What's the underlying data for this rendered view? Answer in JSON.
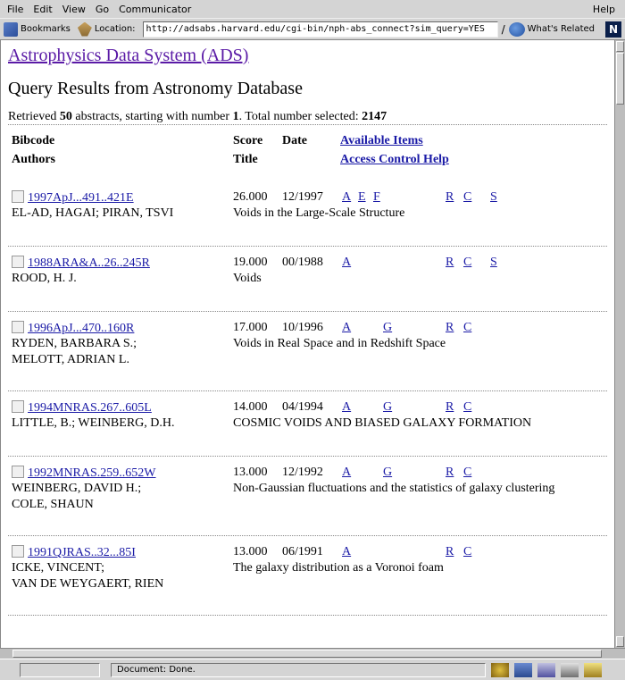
{
  "menubar": {
    "items": [
      "File",
      "Edit",
      "View",
      "Go",
      "Communicator"
    ],
    "help": "Help"
  },
  "toolbar": {
    "bookmarks_label": "Bookmarks",
    "location_label": "Location:",
    "url": "http://adsabs.harvard.edu/cgi-bin/nph-abs_connect?sim_query=YES",
    "related_label": "What's Related",
    "logo": "N"
  },
  "page": {
    "site_title": "Astrophysics Data System (ADS)",
    "heading": "Query Results from Astronomy Database",
    "summary_pre": "Retrieved ",
    "retrieved": "50",
    "summary_mid": " abstracts, starting with number ",
    "start": "1",
    "summary_post": ". Total number selected: ",
    "total": "2147",
    "headers": {
      "bibcode": "Bibcode",
      "authors": "Authors",
      "score": "Score",
      "title": "Title",
      "date": "Date",
      "available_items": "Available Items",
      "access_help": "Access Control Help"
    }
  },
  "results": [
    {
      "bibcode": "1997ApJ...491..421E",
      "score": "26.000",
      "date": "12/1997",
      "links": [
        "A",
        "E",
        "F"
      ],
      "links2": [
        "R",
        "C"
      ],
      "links3": [
        "S"
      ],
      "authors": "EL-AD, HAGAI; PIRAN, TSVI",
      "authors2": "",
      "title": "Voids in the Large-Scale Structure"
    },
    {
      "bibcode": "1988ARA&A..26..245R",
      "score": "19.000",
      "date": "00/1988",
      "links": [
        "A"
      ],
      "links2": [
        "R",
        "C"
      ],
      "links3": [
        "S"
      ],
      "authors": "ROOD, H. J.",
      "authors2": "",
      "title": "Voids"
    },
    {
      "bibcode": "1996ApJ...470..160R",
      "score": "17.000",
      "date": "10/1996",
      "links": [
        "A",
        "G"
      ],
      "links2": [
        "R",
        "C"
      ],
      "links3": [],
      "authors": "RYDEN, BARBARA S.;",
      "authors2": "MELOTT, ADRIAN L.",
      "title": "Voids in Real Space and in Redshift Space"
    },
    {
      "bibcode": "1994MNRAS.267..605L",
      "score": "14.000",
      "date": "04/1994",
      "links": [
        "A",
        "G"
      ],
      "links2": [
        "R",
        "C"
      ],
      "links3": [],
      "authors": "LITTLE, B.; WEINBERG, D.H.",
      "authors2": "",
      "title": "COSMIC VOIDS AND BIASED GALAXY FORMATION"
    },
    {
      "bibcode": "1992MNRAS.259..652W",
      "score": "13.000",
      "date": "12/1992",
      "links": [
        "A",
        "G"
      ],
      "links2": [
        "R",
        "C"
      ],
      "links3": [],
      "authors": "WEINBERG, DAVID H.;",
      "authors2": "COLE, SHAUN",
      "title": "Non-Gaussian fluctuations and the statistics of galaxy clustering"
    },
    {
      "bibcode": "1991QJRAS..32...85I",
      "score": "13.000",
      "date": "06/1991",
      "links": [
        "A"
      ],
      "links2": [
        "R",
        "C"
      ],
      "links3": [],
      "authors": "ICKE, VINCENT;",
      "authors2": "VAN DE WEYGAERT, RIEN",
      "title": "The galaxy distribution as a Voronoi foam"
    }
  ],
  "status": {
    "text": "Document: Done."
  }
}
